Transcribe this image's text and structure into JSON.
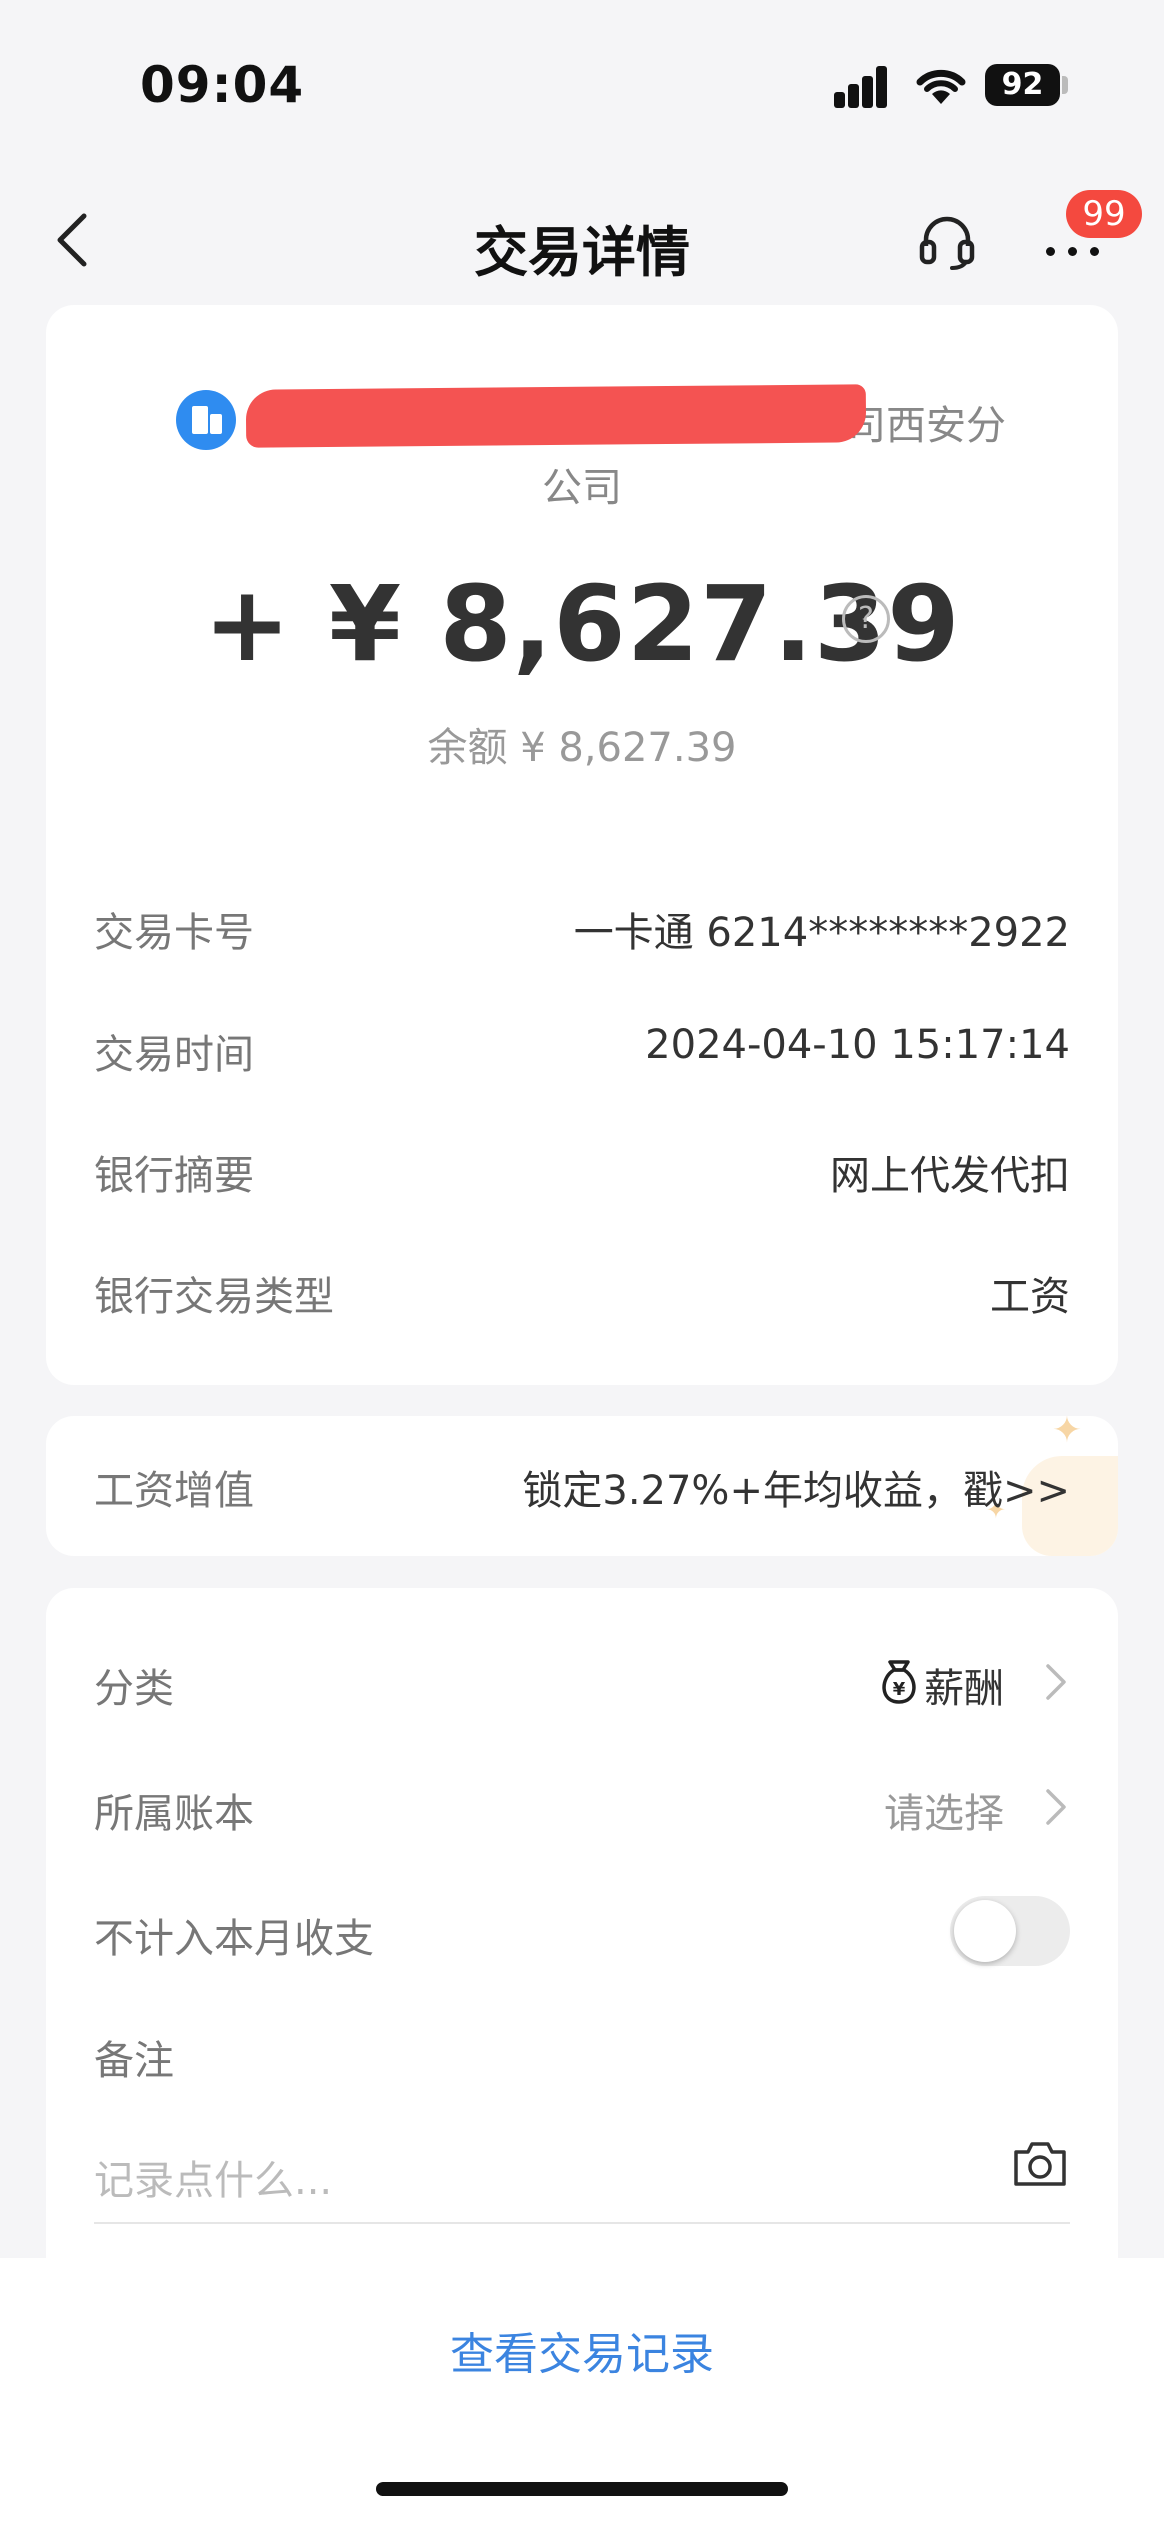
{
  "status_bar": {
    "time": "09:04",
    "battery": "92"
  },
  "nav": {
    "title": "交易详情",
    "badge": "99"
  },
  "merchant": {
    "line1_suffix": "司西安分",
    "line2": "公司"
  },
  "transaction": {
    "amount": "+ ¥ 8,627.39",
    "balance": "余额 ¥ 8,627.39",
    "rows": [
      {
        "label": "交易卡号",
        "value": "一卡通 6214********2922"
      },
      {
        "label": "交易时间",
        "value": "2024-04-10 15:17:14"
      },
      {
        "label": "银行摘要",
        "value": "网上代发代扣"
      },
      {
        "label": "银行交易类型",
        "value": "工资"
      }
    ]
  },
  "promo": {
    "label": "工资增值",
    "text": "锁定3.27%+年均收益，戳>>"
  },
  "settings": {
    "category_label": "分类",
    "category_value": "薪酬",
    "ledger_label": "所属账本",
    "ledger_value": "请选择",
    "exclude_label": "不计入本月收支",
    "exclude_on": false,
    "note_label": "备注",
    "note_placeholder": "记录点什么..."
  },
  "footer": {
    "view_records": "查看交易记录"
  },
  "colors": {
    "accent": "#3b84e0",
    "badge": "#f4493f",
    "merchant_icon": "#2f8cf0",
    "redaction": "#f45352"
  }
}
